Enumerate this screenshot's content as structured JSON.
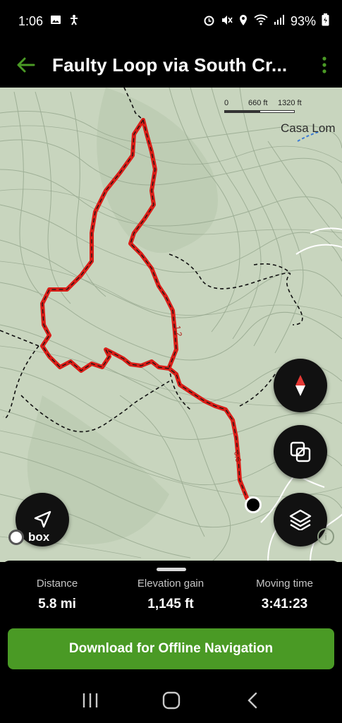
{
  "status_bar": {
    "time": "1:06",
    "battery": "93%",
    "left_icons": [
      "gallery-icon",
      "accessibility-icon"
    ],
    "right_icons": [
      "alarm-icon",
      "mute-icon",
      "location-icon",
      "wifi-icon",
      "signal-icon",
      "battery-icon"
    ]
  },
  "app_bar": {
    "title": "Faulty Loop via South Cr...",
    "back_icon": "arrow-left-icon",
    "more_icon": "more-vert-icon"
  },
  "map": {
    "scale": {
      "zero": "0",
      "mid": "660 ft",
      "end": "1320 ft"
    },
    "place_label": "Casa Lom",
    "trail_color": "#d91e18",
    "mile_markers": [
      "1.2",
      "0.6"
    ],
    "attribution": "box",
    "info": "i",
    "controls": {
      "compass": "compass-icon",
      "overlay": "layers-toggle-icon",
      "layers": "layers-icon",
      "locate": "navigation-arrow-icon"
    }
  },
  "stats": [
    {
      "label": "Distance",
      "value": "5.8 mi"
    },
    {
      "label": "Elevation gain",
      "value": "1,145 ft"
    },
    {
      "label": "Moving time",
      "value": "3:41:23"
    }
  ],
  "download_button": {
    "label": "Download for Offline Navigation",
    "color": "#4a9a25"
  },
  "nav_bar": {
    "icons": [
      "recents-icon",
      "home-icon",
      "back-icon"
    ]
  }
}
